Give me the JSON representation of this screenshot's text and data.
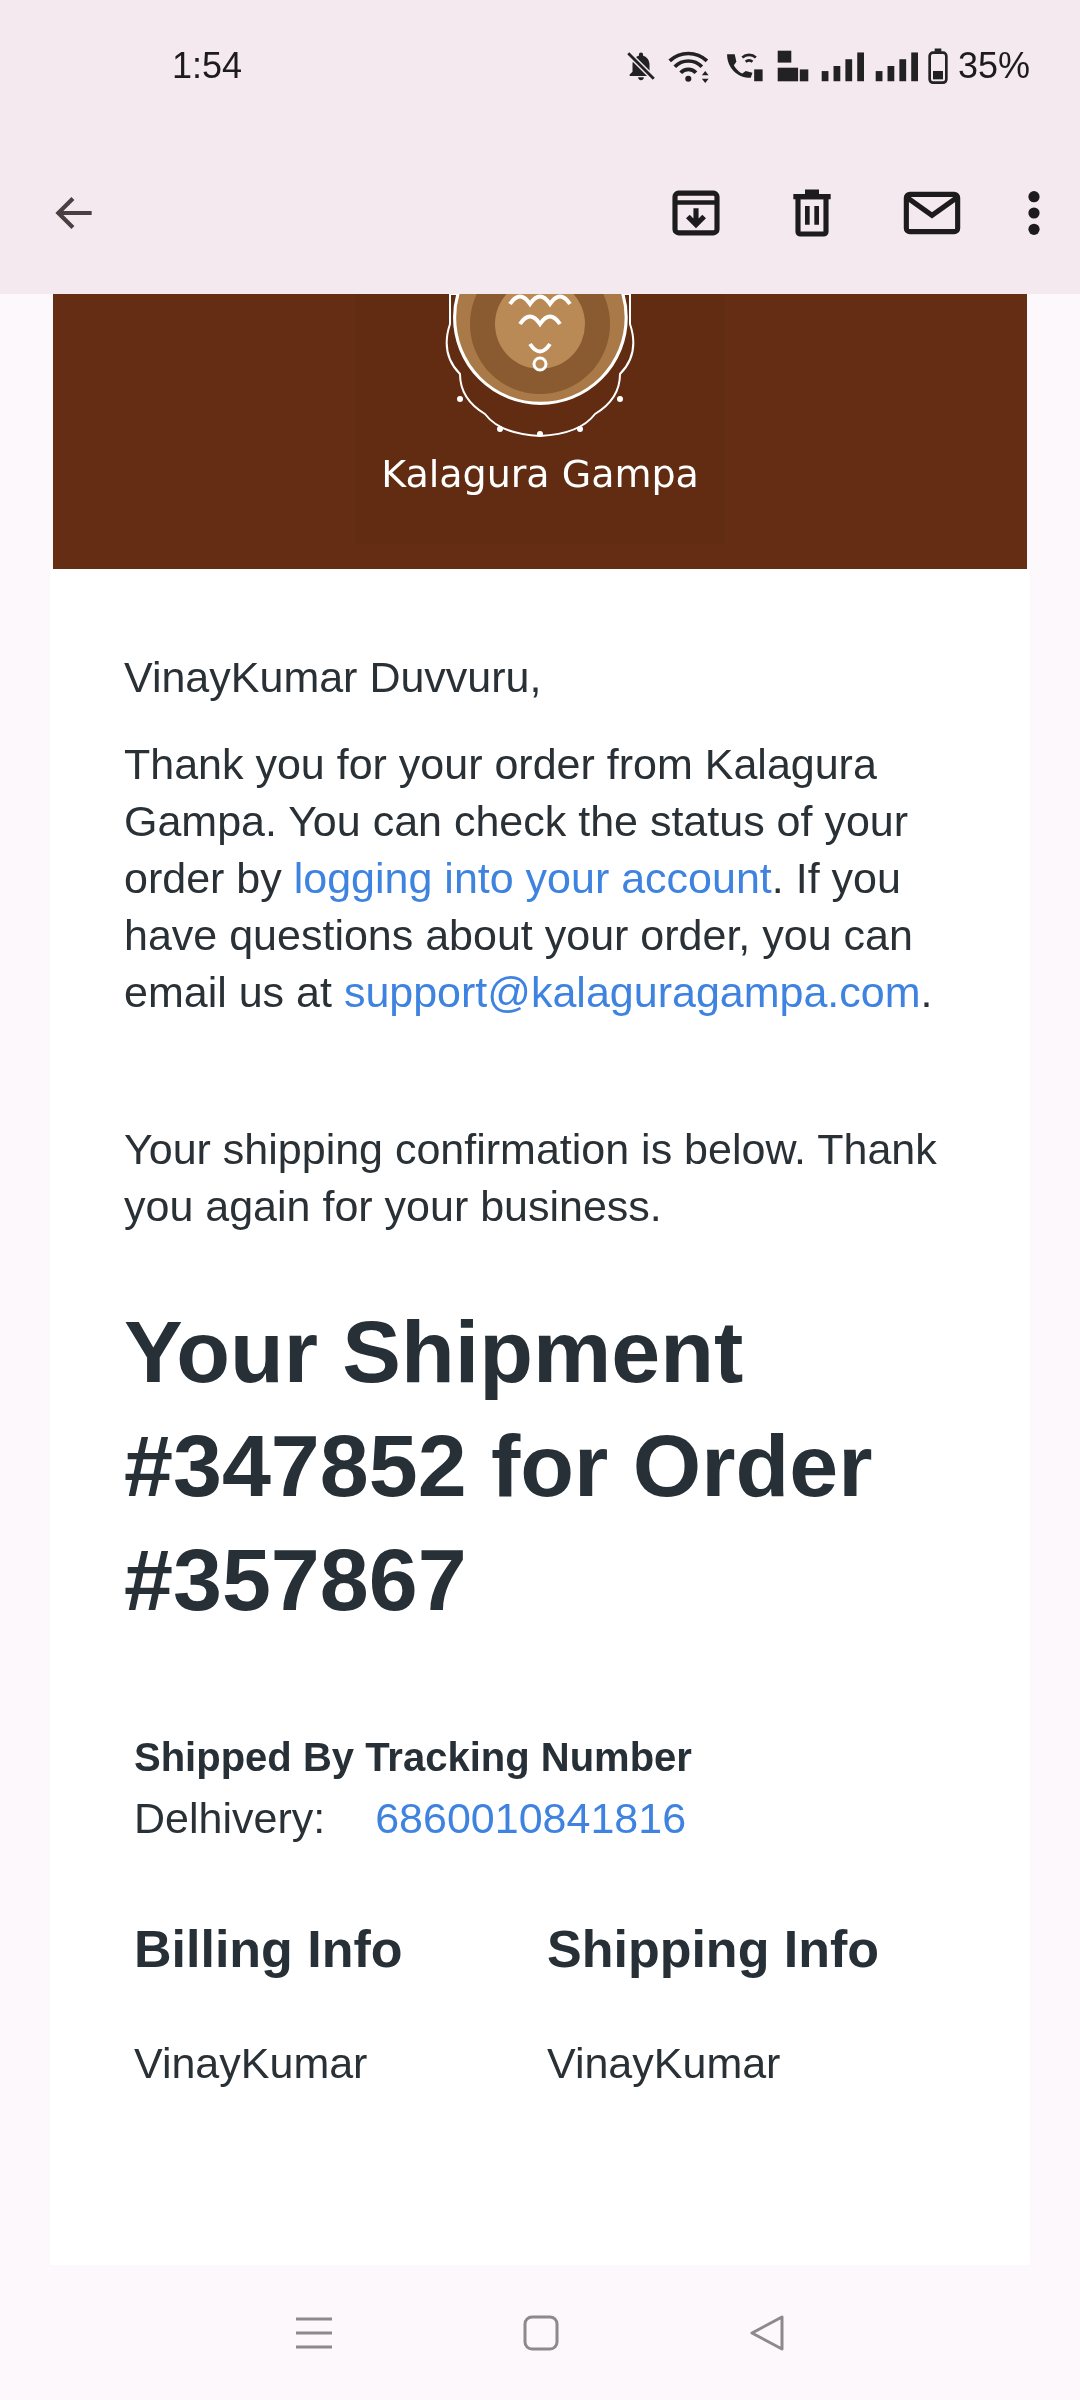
{
  "status_bar": {
    "time": "1:54",
    "battery": "35%"
  },
  "email": {
    "logo_text": "Kalagura Gampa",
    "greeting": "VinayKumar Duvvuru,",
    "intro": [
      {
        "kind": "text",
        "text": "Thank you for your order from Kalagura Gampa. You can check the status of your order by "
      },
      {
        "kind": "link",
        "text": "logging into your account"
      },
      {
        "kind": "text",
        "text": ". If you have questions about your order, you can email us at "
      },
      {
        "kind": "link",
        "text": "support@kalaguragampa.com"
      },
      {
        "kind": "text",
        "text": "."
      }
    ],
    "confirmation": "Your shipping confirmation is below. Thank you again for your business.",
    "shipment_title": "Your Shipment #347852 for Order #357867",
    "tracking": {
      "header": "Shipped By Tracking Number",
      "carrier": "Delhivery:",
      "number": "6860010841816"
    },
    "info_columns": [
      {
        "title": "Billing Info",
        "name": "VinayKumar"
      },
      {
        "title": "Shipping Info",
        "name": "VinayKumar"
      }
    ]
  }
}
